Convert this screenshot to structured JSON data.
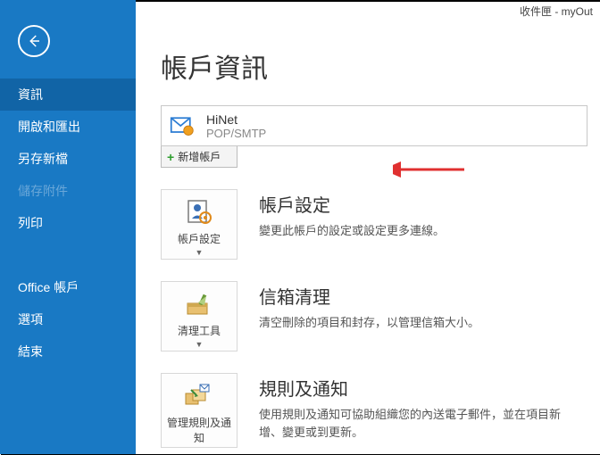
{
  "titlebar": "收件匣 - myOut",
  "sidebar": {
    "items": [
      {
        "label": "資訊",
        "selected": true
      },
      {
        "label": "開啟和匯出"
      },
      {
        "label": "另存新檔"
      },
      {
        "label": "儲存附件",
        "disabled": true
      },
      {
        "label": "列印"
      }
    ],
    "lower": [
      {
        "label": "Office 帳戶"
      },
      {
        "label": "選項"
      },
      {
        "label": "結束"
      }
    ]
  },
  "page_title": "帳戶資訊",
  "account": {
    "name": "HiNet",
    "protocol": "POP/SMTP"
  },
  "add_account_label": "新增帳戶",
  "sections": [
    {
      "tile_label": "帳戶設定",
      "title": "帳戶設定",
      "desc": "變更此帳戶的設定或設定更多連線。"
    },
    {
      "tile_label": "清理工具",
      "title": "信箱清理",
      "desc": "清空刪除的項目和封存，以管理信箱大小。"
    },
    {
      "tile_label": "管理規則及通知",
      "title": "規則及通知",
      "desc": "使用規則及通知可協助組織您的內送電子郵件，並在項目新增、變更或到更新。"
    }
  ]
}
